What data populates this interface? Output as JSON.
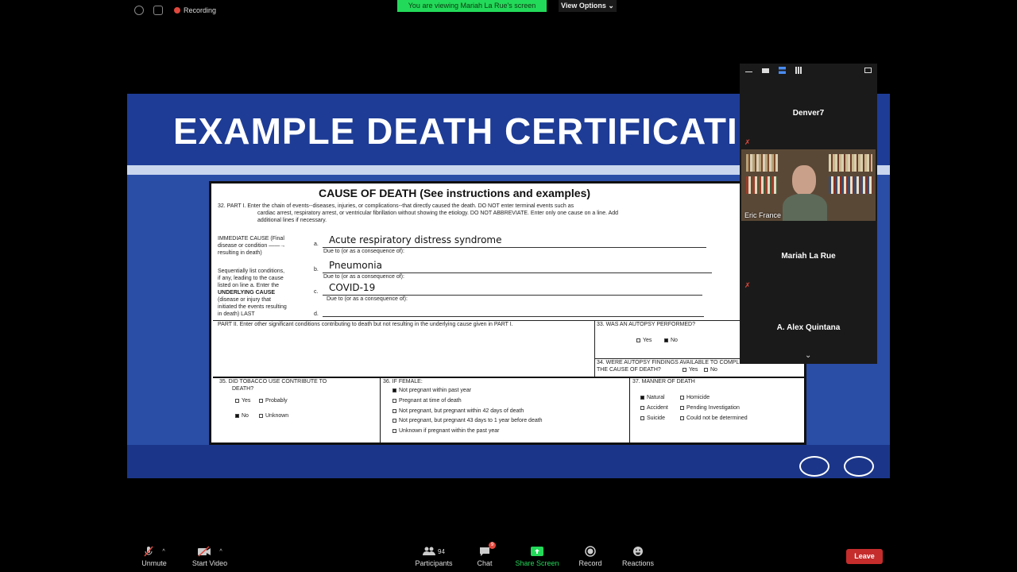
{
  "top_bar": {
    "recording_label": "Recording",
    "viewing_banner": "You are viewing Mariah La Rue's screen",
    "view_options_label": "View Options",
    "colors": {
      "banner": "#23d959",
      "record": "#e0483e"
    }
  },
  "slide": {
    "title": "EXAMPLE DEATH CERTIFICATI",
    "certificate": {
      "heading": "CAUSE OF DEATH (See instructions and examples)",
      "part1_line1": "32.  PART I.  Enter the chain of events--diseases, injuries, or complications--that directly caused the death.  DO NOT enter terminal events such as",
      "part1_line2": "cardiac arrest, respiratory arrest, or ventricular fibrillation without showing the etiology.  DO NOT ABBREVIATE.  Enter only one cause on a line.  Add",
      "part1_line3": "additional lines if necessary.",
      "immediate_label_1": "IMMEDIATE CAUSE (Final",
      "immediate_label_2": "disease  or condition  ——→",
      "immediate_label_3": "resulting  in death)",
      "seq_1": "Sequentially list conditions,",
      "seq_2": "if any,  leading to the cause",
      "seq_3": "listed on line a.  Enter the",
      "seq_4": "UNDERLYING CAUSE",
      "seq_5": "(disease or injury that",
      "seq_6": "initiated the  events resulting",
      "seq_7": "in death) LAST",
      "line_a_letter": "a.",
      "line_b_letter": "b.",
      "line_c_letter": "c.",
      "line_d_letter": "d.",
      "cause_a": "Acute respiratory distress syndrome",
      "cause_b": "Pneumonia",
      "cause_c": "COVID-19",
      "due_to_a": "Due to (or as a consequence of):",
      "due_to_b": "Due to (or as a consequence of):",
      "due_to_c": "Due to (or as a consequence of):",
      "part2": "PART II.  Enter other significant conditions contributing to death but not resulting in the underlying cause given in PART I.",
      "q33": "33.  WAS AN AUTOPSY PERFORMED?",
      "q33_yes": "Yes",
      "q33_no": "No",
      "q34_1": "34.  WERE AUTOPSY FINDINGS AVAILABLE TO COMPLETE",
      "q34_2": "THE CAUSE OF DEATH?",
      "q34_yes": "Yes",
      "q34_no": "No",
      "q35_1": "35.   DID TOBACCO USE CONTRIBUTE TO",
      "q35_2": "DEATH?",
      "q35_yes": "Yes",
      "q35_probably": "Probably",
      "q35_no": "No",
      "q35_unknown": "Unknown",
      "q36": "36.  IF FEMALE:",
      "q36_opt1": "Not pregnant within past year",
      "q36_opt2": "Pregnant at time of death",
      "q36_opt3": "Not pregnant, but pregnant within 42 days of death",
      "q36_opt4": "Not pregnant, but pregnant 43 days to 1 year before death",
      "q36_opt5": "Unknown if pregnant within the past year",
      "q37": "37.  MANNER OF DEATH",
      "q37_natural": "Natural",
      "q37_homicide": "Homicide",
      "q37_accident": "Accident",
      "q37_pending": "Pending Investigation",
      "q37_suicide": "Suicide",
      "q37_undetermined": "Could not be determined"
    }
  },
  "participants_panel": {
    "names": [
      "Denver7",
      "Mariah La Rue",
      "A. Alex Quintana"
    ],
    "video_name": "Eric France"
  },
  "toolbar": {
    "unmute": "Unmute",
    "start_video": "Start Video",
    "participants": "Participants",
    "participants_count": "94",
    "chat": "Chat",
    "chat_badge": "9",
    "share_screen": "Share Screen",
    "record": "Record",
    "reactions": "Reactions",
    "leave": "Leave",
    "colors": {
      "share": "#23d959",
      "leave": "#c52c2c"
    }
  }
}
